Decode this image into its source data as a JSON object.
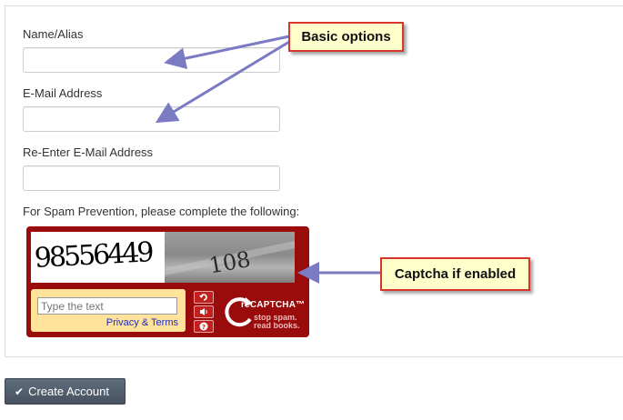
{
  "form": {
    "name_label": "Name/Alias",
    "email_label": "E-Mail Address",
    "reemail_label": "Re-Enter E-Mail Address",
    "spam_label": "For Spam Prevention, please complete the following:",
    "name_value": "",
    "email_value": "",
    "reemail_value": ""
  },
  "captcha": {
    "word1": "98556449",
    "word2": "108",
    "input_placeholder": "Type the text",
    "privacy_link": "Privacy & Terms",
    "brand": "reCAPTCHA™",
    "tagline_1": "stop spam.",
    "tagline_2": "read books.",
    "icons": [
      "refresh-icon",
      "audio-icon",
      "help-icon"
    ],
    "colors": {
      "frame": "#9a0b0b",
      "input_area": "#ffe39a",
      "link": "#1d2bbf"
    }
  },
  "callouts": {
    "basic": "Basic options",
    "captcha": "Captcha if enabled",
    "colors": {
      "fill": "#ffffcc",
      "border": "#d9362b",
      "arrow": "#7b7bc4"
    }
  },
  "actions": {
    "create_account": "Create Account",
    "create_icon": "check-icon"
  }
}
